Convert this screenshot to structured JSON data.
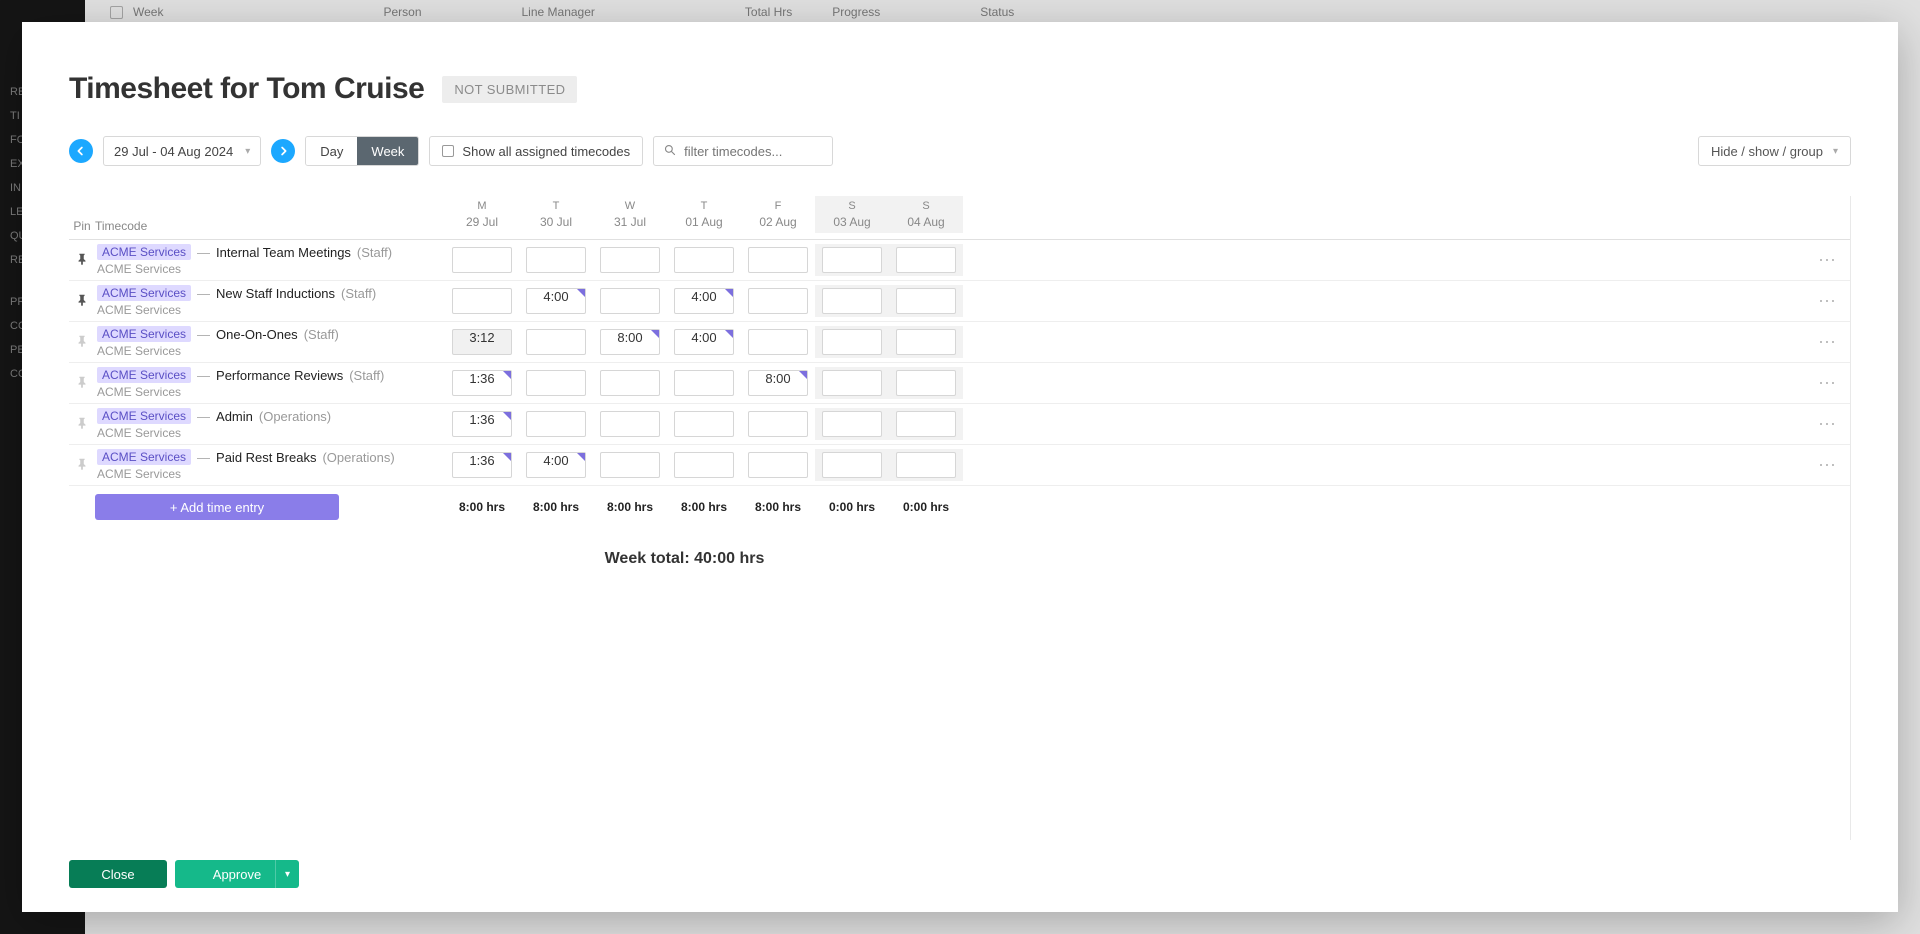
{
  "background": {
    "sidebar_items": [
      "RE",
      "TI",
      "FO",
      "EX",
      "IN",
      "LE",
      "QU",
      "RE",
      "",
      "PR",
      "CO",
      "PE",
      "CO"
    ],
    "table_headers": [
      "Week",
      "Person",
      "Line Manager",
      "Total Hrs",
      "Progress",
      "Status"
    ]
  },
  "modal": {
    "title": "Timesheet for Tom Cruise",
    "status": "NOT SUBMITTED",
    "toolbar": {
      "date_range": "29 Jul - 04 Aug 2024",
      "view_day": "Day",
      "view_week": "Week",
      "show_all_label": "Show all assigned timecodes",
      "filter_placeholder": "filter timecodes...",
      "hide_show_label": "Hide / show / group"
    },
    "headers": {
      "pin": "Pin",
      "timecode": "Timecode",
      "days": [
        {
          "dow": "M",
          "date": "29 Jul",
          "weekend": false
        },
        {
          "dow": "T",
          "date": "30 Jul",
          "weekend": false
        },
        {
          "dow": "W",
          "date": "31 Jul",
          "weekend": false
        },
        {
          "dow": "T",
          "date": "01 Aug",
          "weekend": false
        },
        {
          "dow": "F",
          "date": "02 Aug",
          "weekend": false
        },
        {
          "dow": "S",
          "date": "03 Aug",
          "weekend": true
        },
        {
          "dow": "S",
          "date": "04 Aug",
          "weekend": true
        }
      ]
    },
    "rows": [
      {
        "pinned": true,
        "client": "ACME Services",
        "task": "Internal Team Meetings",
        "category": "(Staff)",
        "subclient": "ACME Services",
        "cells": [
          {
            "val": "",
            "note": false
          },
          {
            "val": "",
            "note": false
          },
          {
            "val": "",
            "note": false
          },
          {
            "val": "",
            "note": false
          },
          {
            "val": "",
            "note": false
          },
          {
            "val": "",
            "note": false
          },
          {
            "val": "",
            "note": false
          }
        ]
      },
      {
        "pinned": true,
        "client": "ACME Services",
        "task": "New Staff Inductions",
        "category": "(Staff)",
        "subclient": "ACME Services",
        "cells": [
          {
            "val": "",
            "note": false
          },
          {
            "val": "4:00",
            "note": true
          },
          {
            "val": "",
            "note": false
          },
          {
            "val": "4:00",
            "note": true
          },
          {
            "val": "",
            "note": false
          },
          {
            "val": "",
            "note": false
          },
          {
            "val": "",
            "note": false
          }
        ]
      },
      {
        "pinned": false,
        "client": "ACME Services",
        "task": "One-On-Ones",
        "category": "(Staff)",
        "subclient": "ACME Services",
        "cells": [
          {
            "val": "3:12",
            "note": false,
            "shaded": true
          },
          {
            "val": "",
            "note": false
          },
          {
            "val": "8:00",
            "note": true
          },
          {
            "val": "4:00",
            "note": true
          },
          {
            "val": "",
            "note": false
          },
          {
            "val": "",
            "note": false
          },
          {
            "val": "",
            "note": false
          }
        ]
      },
      {
        "pinned": false,
        "client": "ACME Services",
        "task": "Performance Reviews",
        "category": "(Staff)",
        "subclient": "ACME Services",
        "cells": [
          {
            "val": "1:36",
            "note": true
          },
          {
            "val": "",
            "note": false
          },
          {
            "val": "",
            "note": false
          },
          {
            "val": "",
            "note": false
          },
          {
            "val": "8:00",
            "note": true
          },
          {
            "val": "",
            "note": false
          },
          {
            "val": "",
            "note": false
          }
        ]
      },
      {
        "pinned": false,
        "client": "ACME Services",
        "task": "Admin",
        "category": "(Operations)",
        "subclient": "ACME Services",
        "cells": [
          {
            "val": "1:36",
            "note": true
          },
          {
            "val": "",
            "note": false
          },
          {
            "val": "",
            "note": false
          },
          {
            "val": "",
            "note": false
          },
          {
            "val": "",
            "note": false
          },
          {
            "val": "",
            "note": false
          },
          {
            "val": "",
            "note": false
          }
        ]
      },
      {
        "pinned": false,
        "client": "ACME Services",
        "task": "Paid Rest Breaks",
        "category": "(Operations)",
        "subclient": "ACME Services",
        "cells": [
          {
            "val": "1:36",
            "note": true
          },
          {
            "val": "4:00",
            "note": true
          },
          {
            "val": "",
            "note": false
          },
          {
            "val": "",
            "note": false
          },
          {
            "val": "",
            "note": false
          },
          {
            "val": "",
            "note": false
          },
          {
            "val": "",
            "note": false
          }
        ]
      }
    ],
    "add_entry_label": "+ Add time entry",
    "day_totals": [
      "8:00 hrs",
      "8:00 hrs",
      "8:00 hrs",
      "8:00 hrs",
      "8:00 hrs",
      "0:00 hrs",
      "0:00 hrs"
    ],
    "week_total": "Week total: 40:00 hrs",
    "footer": {
      "close": "Close",
      "approve": "Approve"
    }
  }
}
